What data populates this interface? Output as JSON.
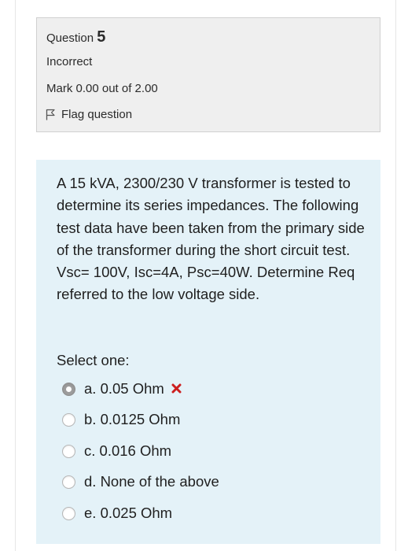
{
  "question_info": {
    "label": "Question",
    "number": "5",
    "state": "Incorrect",
    "grade": "Mark 0.00 out of 2.00",
    "flag_label": "Flag question"
  },
  "question": {
    "text": "A 15 kVA, 2300/230 V transformer is tested to determine its series impedances. The following test data have been taken from the primary side of the transformer during the short circuit test. Vsc= 100V, Isc=4A, Psc=40W. Determine Req referred to the low voltage side.",
    "prompt": "Select one:",
    "options": [
      {
        "label": "a. 0.05 Ohm",
        "selected": true,
        "feedback": "incorrect"
      },
      {
        "label": "b. 0.0125 Ohm",
        "selected": false
      },
      {
        "label": "c. 0.016 Ohm",
        "selected": false
      },
      {
        "label": "d. None of the above",
        "selected": false
      },
      {
        "label": "e. 0.025 Ohm",
        "selected": false
      }
    ]
  },
  "colors": {
    "info_bg": "#efefef",
    "content_bg": "#e4f2f8",
    "incorrect_mark": "#cc1f1f"
  }
}
